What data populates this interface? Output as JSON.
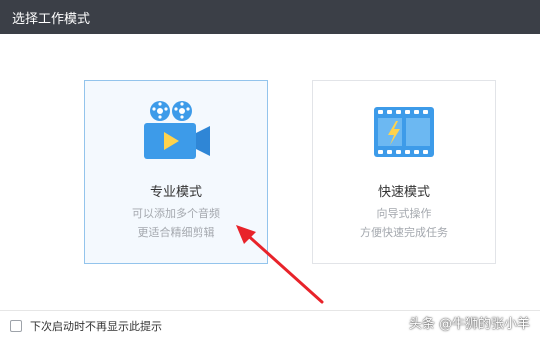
{
  "window": {
    "title": "选择工作模式"
  },
  "modes": [
    {
      "icon": "video-camera-icon",
      "title": "专业模式",
      "desc1": "可以添加多个音频",
      "desc2": "更适合精细剪辑",
      "selected": true
    },
    {
      "icon": "film-strip-flash-icon",
      "title": "快速模式",
      "desc1": "向导式操作",
      "desc2": "方便快速完成任务",
      "selected": false
    }
  ],
  "annotation": {
    "arrow_color": "#e8232a"
  },
  "footer": {
    "checkbox_label": "下次启动时不再显示此提示",
    "checked": false
  },
  "watermark": "头条 @牛狮的张小羊",
  "colors": {
    "accent": "#3d9be9",
    "titlebar": "#3b3f47"
  }
}
